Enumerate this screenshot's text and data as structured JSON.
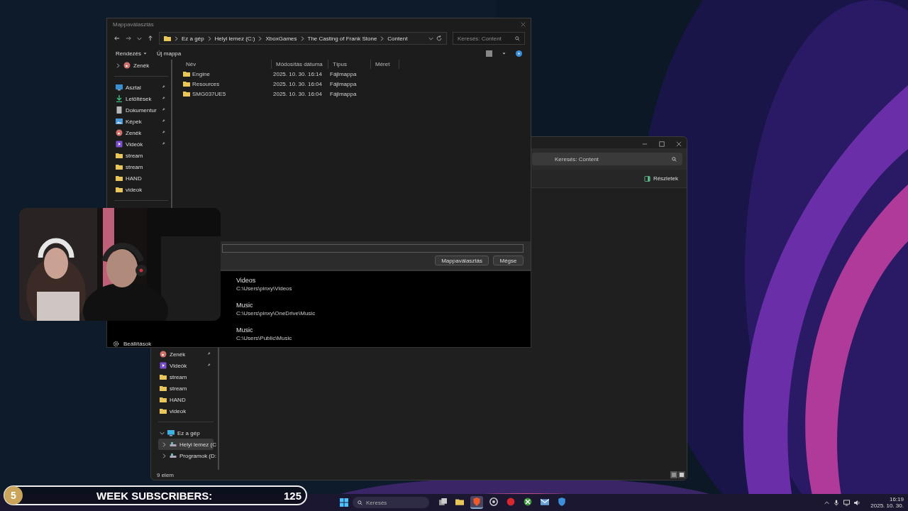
{
  "dialog": {
    "title": "Mappaválasztás",
    "breadcrumb": [
      "Ez a gép",
      "Helyi lemez (C:)",
      "XboxGames",
      "The Casting of Frank Stone",
      "Content"
    ],
    "search": {
      "placeholder": "Keresés: Content"
    },
    "commands": [
      "Rendezés",
      "Új mappa"
    ],
    "sidebar_top": {
      "label": "Zenék",
      "kind": "music",
      "expanded": false
    },
    "sidebar": [
      {
        "label": "Asztal",
        "kind": "desktop",
        "pinned": true
      },
      {
        "label": "Letöltések",
        "kind": "download",
        "pinned": true
      },
      {
        "label": "Dokumentur",
        "kind": "document",
        "pinned": true
      },
      {
        "label": "Képek",
        "kind": "picture",
        "pinned": true
      },
      {
        "label": "Zenék",
        "kind": "music",
        "pinned": true
      },
      {
        "label": "Videók",
        "kind": "video",
        "pinned": true
      },
      {
        "label": "stream",
        "kind": "folder",
        "pinned": false
      },
      {
        "label": "stream",
        "kind": "folder",
        "pinned": false
      },
      {
        "label": "HAND",
        "kind": "folder",
        "pinned": false
      },
      {
        "label": "videok",
        "kind": "folder",
        "pinned": false
      }
    ],
    "columns": [
      "Név",
      "Módosítás dátuma",
      "Típus",
      "Méret"
    ],
    "rows": [
      {
        "name": "Engine",
        "modified": "2025. 10. 30. 16:14",
        "type": "Fájlmappa"
      },
      {
        "name": "Resources",
        "modified": "2025. 10. 30. 16:04",
        "type": "Fájlmappa"
      },
      {
        "name": "SMG037UE5",
        "modified": "2025. 10. 30. 16:04",
        "type": "Fájlmappa"
      }
    ],
    "buttons": [
      "Mappaválasztás",
      "Mégse"
    ]
  },
  "popup": {
    "items": [
      {
        "title": "Videos",
        "path": "C:\\Users\\pinxy\\Videos"
      },
      {
        "title": "Music",
        "path": "C:\\Users\\pinxy\\OneDrive\\Music"
      },
      {
        "title": "Music",
        "path": "C:\\Users\\Public\\Music"
      }
    ],
    "settings": "Beállítások"
  },
  "explorer": {
    "search": {
      "placeholder": "Keresés: Content"
    },
    "details": "Részletek",
    "sidebar": [
      {
        "label": "Zenék",
        "kind": "music",
        "pinned": true
      },
      {
        "label": "Videók",
        "kind": "video",
        "pinned": true
      },
      {
        "label": "stream",
        "kind": "folder",
        "pinned": false
      },
      {
        "label": "stream",
        "kind": "folder",
        "pinned": false
      },
      {
        "label": "HAND",
        "kind": "folder",
        "pinned": false
      },
      {
        "label": "videok",
        "kind": "folder",
        "pinned": false
      }
    ],
    "tree": [
      {
        "label": "Ez a gép",
        "kind": "pc",
        "expanded": true,
        "selected": false,
        "children": [
          {
            "label": "Helyi lemez (C",
            "kind": "drive",
            "expanded": false,
            "selected": true
          },
          {
            "label": "Programok (D:",
            "kind": "drive",
            "expanded": false,
            "selected": false
          }
        ]
      }
    ],
    "status": "9 elem"
  },
  "overlay": {
    "count": "5",
    "label": "WEEK SUBSCRIBERS:",
    "value": "125"
  },
  "taskbar": {
    "search": {
      "placeholder": "Keresés"
    },
    "apps": [
      {
        "kind": "taskview",
        "selected": false
      },
      {
        "kind": "files",
        "selected": false
      },
      {
        "kind": "brave",
        "selected": true
      },
      {
        "kind": "chrome",
        "selected": false
      },
      {
        "kind": "red",
        "selected": false
      },
      {
        "kind": "xbox",
        "selected": false
      },
      {
        "kind": "mail",
        "selected": false
      },
      {
        "kind": "security",
        "selected": false
      }
    ],
    "time": "16:19",
    "date": "2025. 10. 30."
  }
}
